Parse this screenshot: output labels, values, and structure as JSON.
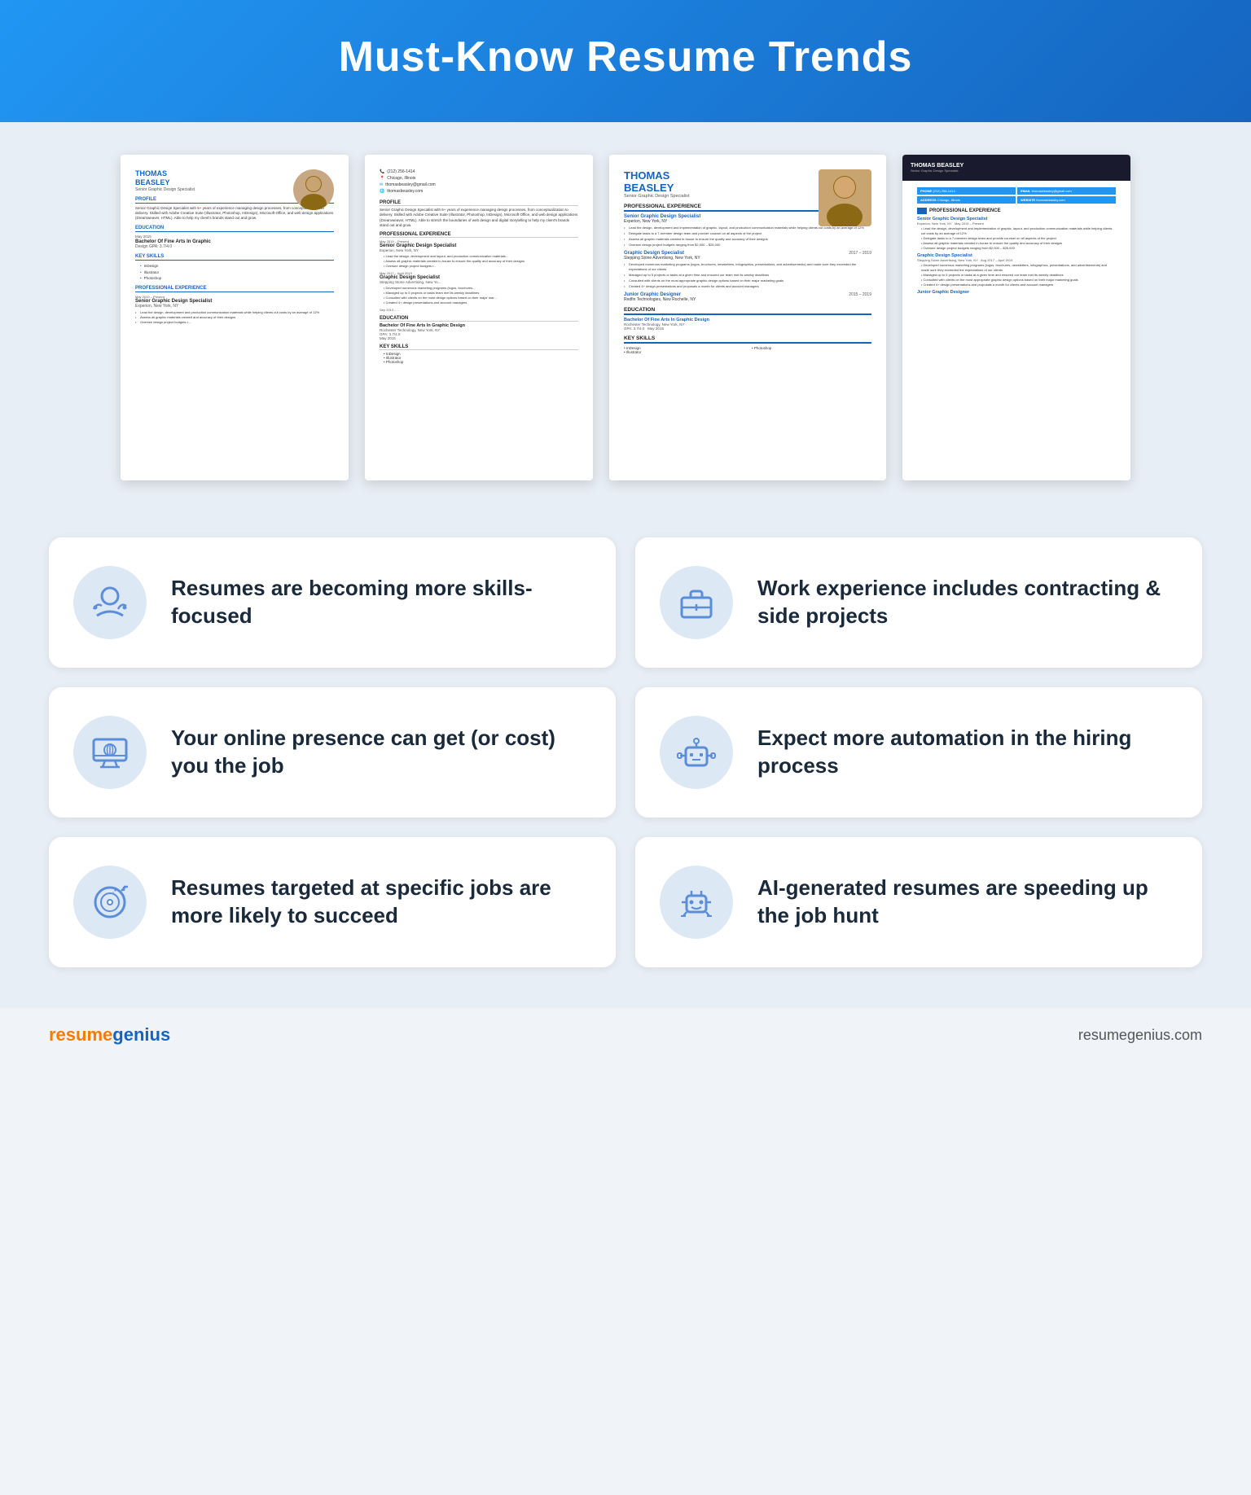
{
  "header": {
    "title": "Must-Know Resume Trends"
  },
  "resumes": {
    "person": {
      "name": "THOMAS BEASLEY",
      "title": "Senior Graphic Design Specialist",
      "phone": "(212) 256-1414",
      "location": "Chicago, Illinois",
      "email": "thomasbeasley@gmail.com",
      "website": "thomasbeasley.com",
      "gpa": "GPA: 3.7/4.0",
      "degree": "Bachelor Of Fine Arts In Graphic Design",
      "school": "Rochester Technology, New York, NY",
      "grad_date": "May 2015"
    }
  },
  "trends": [
    {
      "id": "skills-focused",
      "text": "Resumes are becoming more skills-focused",
      "icon": "skills-icon"
    },
    {
      "id": "contracting",
      "text": "Work experience includes contracting & side projects",
      "icon": "briefcase-icon"
    },
    {
      "id": "online-presence",
      "text": "Your online presence can get (or cost) you the job",
      "icon": "monitor-icon"
    },
    {
      "id": "automation",
      "text": "Expect more automation in the hiring process",
      "icon": "robot-icon"
    },
    {
      "id": "targeted",
      "text": "Resumes targeted at specific jobs are more likely to succeed",
      "icon": "target-icon"
    },
    {
      "id": "ai-generated",
      "text": "AI-generated resumes are speeding up the job hunt",
      "icon": "ai-icon"
    }
  ],
  "footer": {
    "brand_part1": "resume",
    "brand_part2": "genius",
    "url": "resumegenius.com"
  }
}
